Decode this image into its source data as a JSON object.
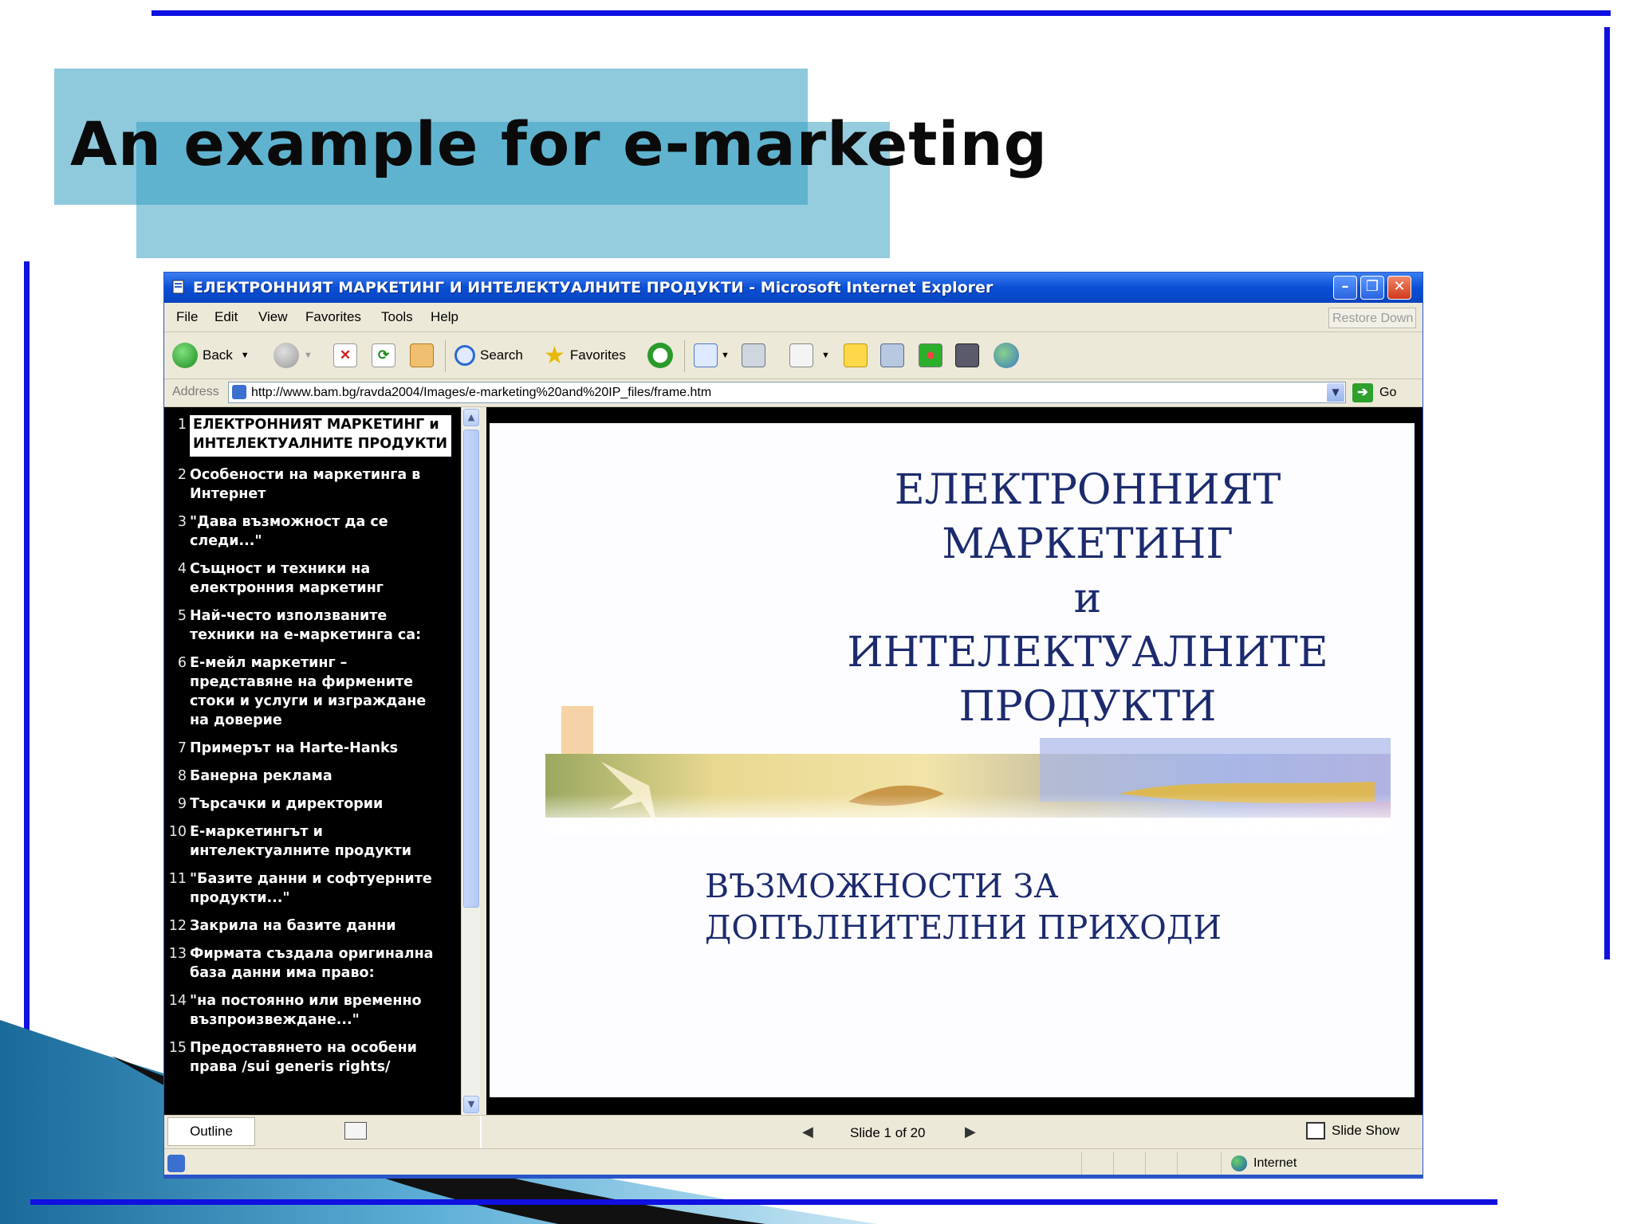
{
  "slide_title": "An example for e-marketing",
  "browser": {
    "window_title": "ЕЛЕКТРОННИЯТ МАРКЕТИНГ И ИНТЕЛЕКТУАЛНИТЕ ПРОДУКТИ - Microsoft Internet Explorer",
    "menu": [
      "File",
      "Edit",
      "View",
      "Favorites",
      "Tools",
      "Help"
    ],
    "restore_label": "Restore Down",
    "toolbar": {
      "back": "Back",
      "search": "Search",
      "favorites": "Favorites"
    },
    "address_label": "Address",
    "url": "http://www.bam.bg/ravda2004/Images/e-marketing%20and%20IP_files/frame.htm",
    "go_label": "Go",
    "status_zone": "Internet"
  },
  "outline": [
    {
      "num": "1",
      "text": "ЕЛЕКТРОННИЯТ МАРКЕТИНГ и ИНТЕЛЕКТУАЛНИТЕ ПРОДУКТИ",
      "selected": true
    },
    {
      "num": "2",
      "text": "Особености на маркетинга в Интернет"
    },
    {
      "num": "3",
      "text": "\"Дава възможност да се следи...\""
    },
    {
      "num": "4",
      "text": "Същност и техники на електронния маркетинг"
    },
    {
      "num": "5",
      "text": "Най-често използваните техники на е-маркетинга са:"
    },
    {
      "num": "6",
      "text": "Е-мейл маркетинг – представяне на фирмените стоки и услуги и изграждане на доверие"
    },
    {
      "num": "7",
      "text": "Примерът на Harte-Hanks"
    },
    {
      "num": "8",
      "text": "Банерна реклама"
    },
    {
      "num": "9",
      "text": "Търсачки и директории"
    },
    {
      "num": "10",
      "text": "Е-маркетингът и интелектуалните продукти"
    },
    {
      "num": "11",
      "text": "\"Базите данни и софтуерните продукти...\""
    },
    {
      "num": "12",
      "text": "Закрила на базите данни"
    },
    {
      "num": "13",
      "text": "Фирмата създала оригинална база данни има право:"
    },
    {
      "num": "14",
      "text": "\"на постоянно или временно възпроизвеждане...\""
    },
    {
      "num": "15",
      "text": "Предоставянето на особени права /sui generis rights/"
    }
  ],
  "slide": {
    "title_lines": [
      "ЕЛЕКТРОННИЯТ",
      "МАРКЕТИНГ",
      "и",
      "ИНТЕЛЕКТУАЛНИТЕ",
      "ПРОДУКТИ"
    ],
    "subtitle_lines": [
      "ВЪЗМОЖНОСТИ ЗА",
      "ДОПЪЛНИТЕЛНИ ПРИХОДИ"
    ]
  },
  "controls": {
    "outline_tab": "Outline",
    "slide_counter": "Slide 1 of 20",
    "slide_show": "Slide Show"
  }
}
